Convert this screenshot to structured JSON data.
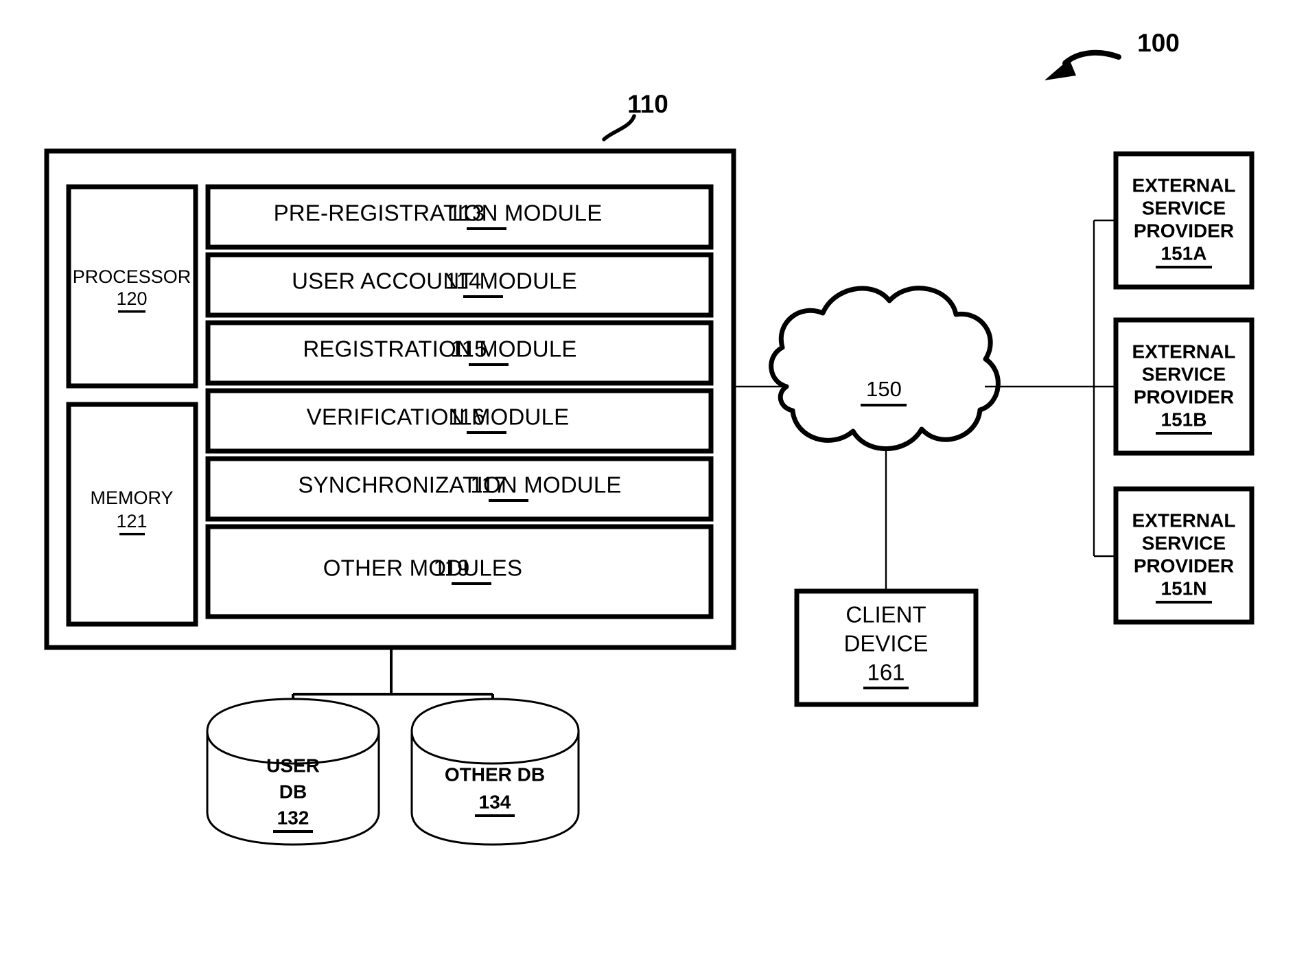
{
  "figure": {
    "figure_ref": "100",
    "system_ref": "110"
  },
  "system": {
    "processor": {
      "name": "PROCESSOR",
      "ref": "120"
    },
    "memory": {
      "name": "MEMORY",
      "ref": "121"
    },
    "modules": [
      {
        "label": "PRE-REGISTRATION MODULE",
        "ref": "113"
      },
      {
        "label": "USER ACCOUNT MODULE",
        "ref": "114"
      },
      {
        "label": "REGISTRATION MODULE",
        "ref": "115"
      },
      {
        "label": "VERIFICATION MODULE",
        "ref": "116"
      },
      {
        "label": "SYNCHRONIZATION MODULE",
        "ref": "117"
      },
      {
        "label": "OTHER MODULES",
        "ref": "119"
      }
    ]
  },
  "databases": [
    {
      "line1": "USER",
      "line2": "DB",
      "ref": "132"
    },
    {
      "line1": "OTHER DB",
      "line2": "",
      "ref": "134"
    }
  ],
  "network": {
    "label": "",
    "ref": "150"
  },
  "client_device": {
    "line1": "CLIENT",
    "line2": "DEVICE",
    "ref": "161"
  },
  "external_service_providers": [
    {
      "line1": "EXTERNAL",
      "line2": "SERVICE",
      "line3": "PROVIDER",
      "ref": "151A"
    },
    {
      "line1": "EXTERNAL",
      "line2": "SERVICE",
      "line3": "PROVIDER",
      "ref": "151B"
    },
    {
      "line1": "EXTERNAL",
      "line2": "SERVICE",
      "line3": "PROVIDER",
      "ref": "151N"
    }
  ],
  "colors": {
    "ink": "#000000",
    "paper": "#ffffff"
  }
}
